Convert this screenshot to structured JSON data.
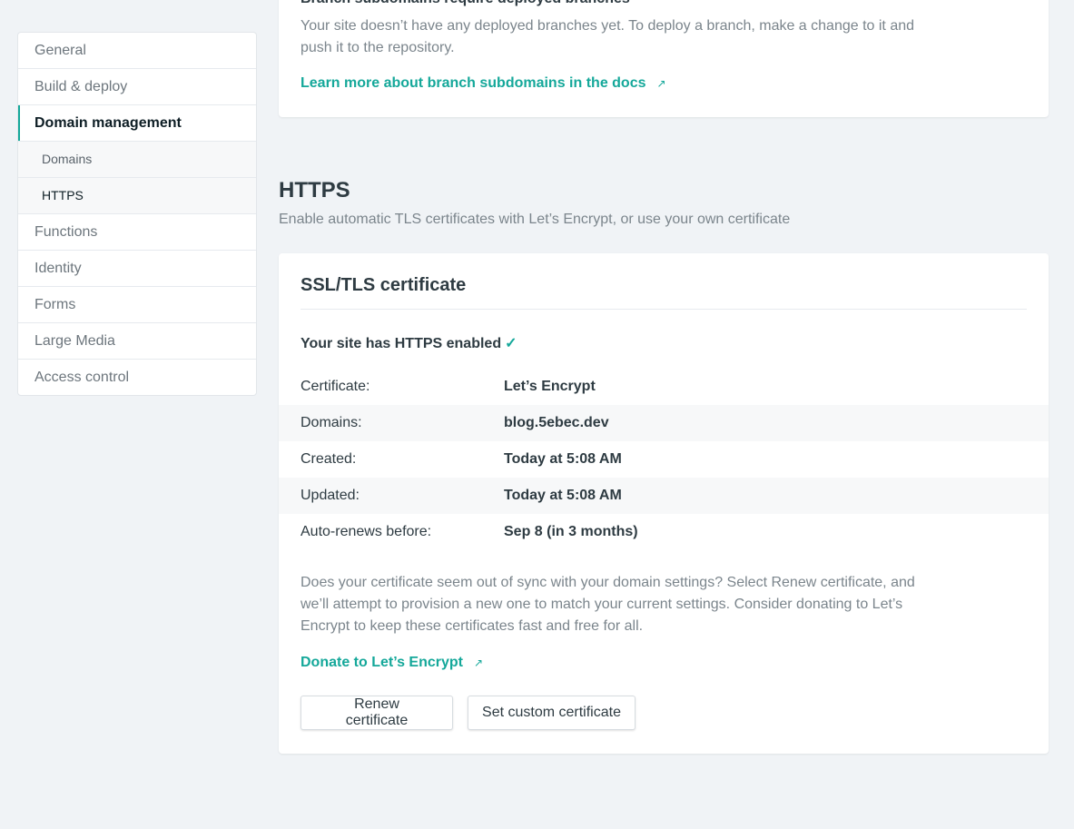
{
  "sidebar": {
    "items": [
      {
        "label": "General"
      },
      {
        "label": "Build & deploy"
      },
      {
        "label": "Domain management"
      },
      {
        "label": "Domains"
      },
      {
        "label": "HTTPS"
      },
      {
        "label": "Functions"
      },
      {
        "label": "Identity"
      },
      {
        "label": "Forms"
      },
      {
        "label": "Large Media"
      },
      {
        "label": "Access control"
      }
    ]
  },
  "branch_card": {
    "heading": "Branch subdomains require deployed branches",
    "description": "Your site doesn’t have any deployed branches yet. To deploy a branch, make a change to it and push it to the repository.",
    "link": "Learn more about branch subdomains in the docs",
    "link_icon": "↗"
  },
  "https_section": {
    "title": "HTTPS",
    "subtitle": "Enable automatic TLS certificates with Let’s Encrypt, or use your own certificate"
  },
  "ssl_card": {
    "title": "SSL/TLS certificate",
    "status": "Your site has HTTPS enabled",
    "status_icon": "✓",
    "rows": [
      {
        "label": "Certificate:",
        "value": "Let’s Encrypt"
      },
      {
        "label": "Domains:",
        "value": "blog.5ebec.dev"
      },
      {
        "label": "Created:",
        "value": "Today at 5:08 AM"
      },
      {
        "label": "Updated:",
        "value": "Today at 5:08 AM"
      },
      {
        "label": "Auto-renews before:",
        "value": "Sep 8 (in 3 months)"
      }
    ],
    "note": "Does your certificate seem out of sync with your domain settings? Select Renew certificate, and we’ll attempt to provision a new one to match your current settings. Consider donating to Let’s Encrypt to keep these certificates fast and free for all.",
    "donate_link": "Donate to Let’s Encrypt",
    "donate_icon": "↗",
    "renew_button": "Renew certificate",
    "custom_button": "Set custom certificate"
  },
  "colors": {
    "accent": "#15a89a",
    "background": "#f0f3f6"
  }
}
